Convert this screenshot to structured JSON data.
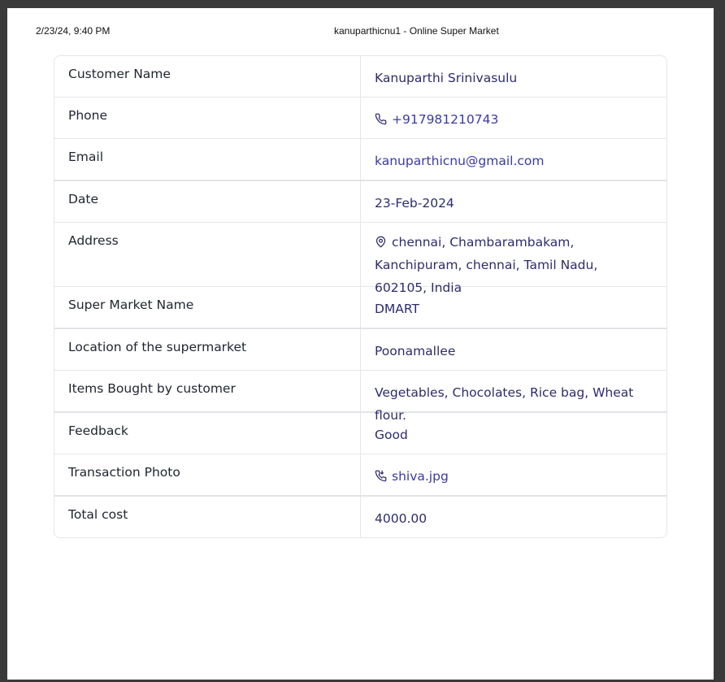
{
  "print_header": {
    "datetime": "2/23/24, 9:40 PM",
    "title": "kanuparthicnu1 - Online Super Market"
  },
  "details": [
    {
      "label": "Customer Name",
      "value": "Kanuparthi Srinivasulu"
    },
    {
      "label": "Phone",
      "value": "+917981210743",
      "icon": "phone-icon"
    },
    {
      "label": "Email",
      "value": "kanuparthicnu@gmail.com"
    },
    {
      "label": "Date",
      "value": "23-Feb-2024"
    },
    {
      "label": "Address",
      "value": "chennai, Chambarambakam, Kanchipuram, chennai, Tamil Nadu, 602105, India",
      "icon": "location-pin-icon"
    },
    {
      "label": "Super Market Name",
      "value": "DMART"
    },
    {
      "label": "Location of the supermarket",
      "value": "Poonamallee"
    },
    {
      "label": "Items Bought by customer",
      "value": "Vegetables, Chocolates, Rice bag, Wheat flour."
    },
    {
      "label": "Feedback",
      "value": "Good"
    },
    {
      "label": "Transaction Photo",
      "value": "shiva.jpg",
      "icon": "attachment-call-icon"
    },
    {
      "label": "Total cost",
      "value": "4000.00"
    }
  ],
  "colors": {
    "label_text": "#1f2430",
    "value_text": "#2c2c6e",
    "link_text": "#3a3aa6",
    "border": "#e4e6ea"
  }
}
